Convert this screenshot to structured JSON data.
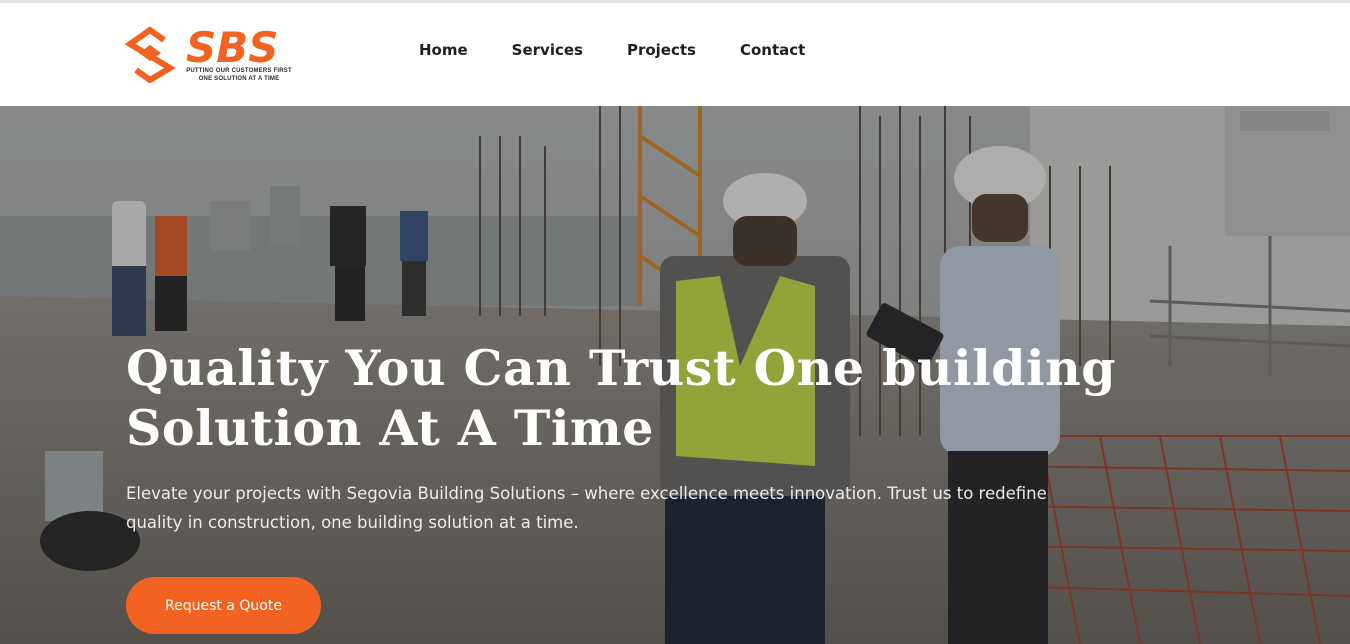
{
  "brand": {
    "name": "SBS",
    "tagline_line1": "PUTTING OUR CUSTOMERS FIRST",
    "tagline_line2": "ONE SOLUTION AT A TIME",
    "colors": {
      "orange": "#f26322",
      "dark": "#3a3a3a"
    }
  },
  "nav": {
    "items": [
      {
        "label": "Home"
      },
      {
        "label": "Services"
      },
      {
        "label": "Projects"
      },
      {
        "label": "Contact"
      }
    ]
  },
  "hero": {
    "title": "Quality You Can Trust One building Solution At A Time",
    "subtitle": "Elevate your projects with Segovia Building Solutions – where excellence meets innovation. Trust us to redefine quality in construction, one building solution at a time.",
    "cta_label": "Request a Quote",
    "background": "construction-site-photo"
  }
}
